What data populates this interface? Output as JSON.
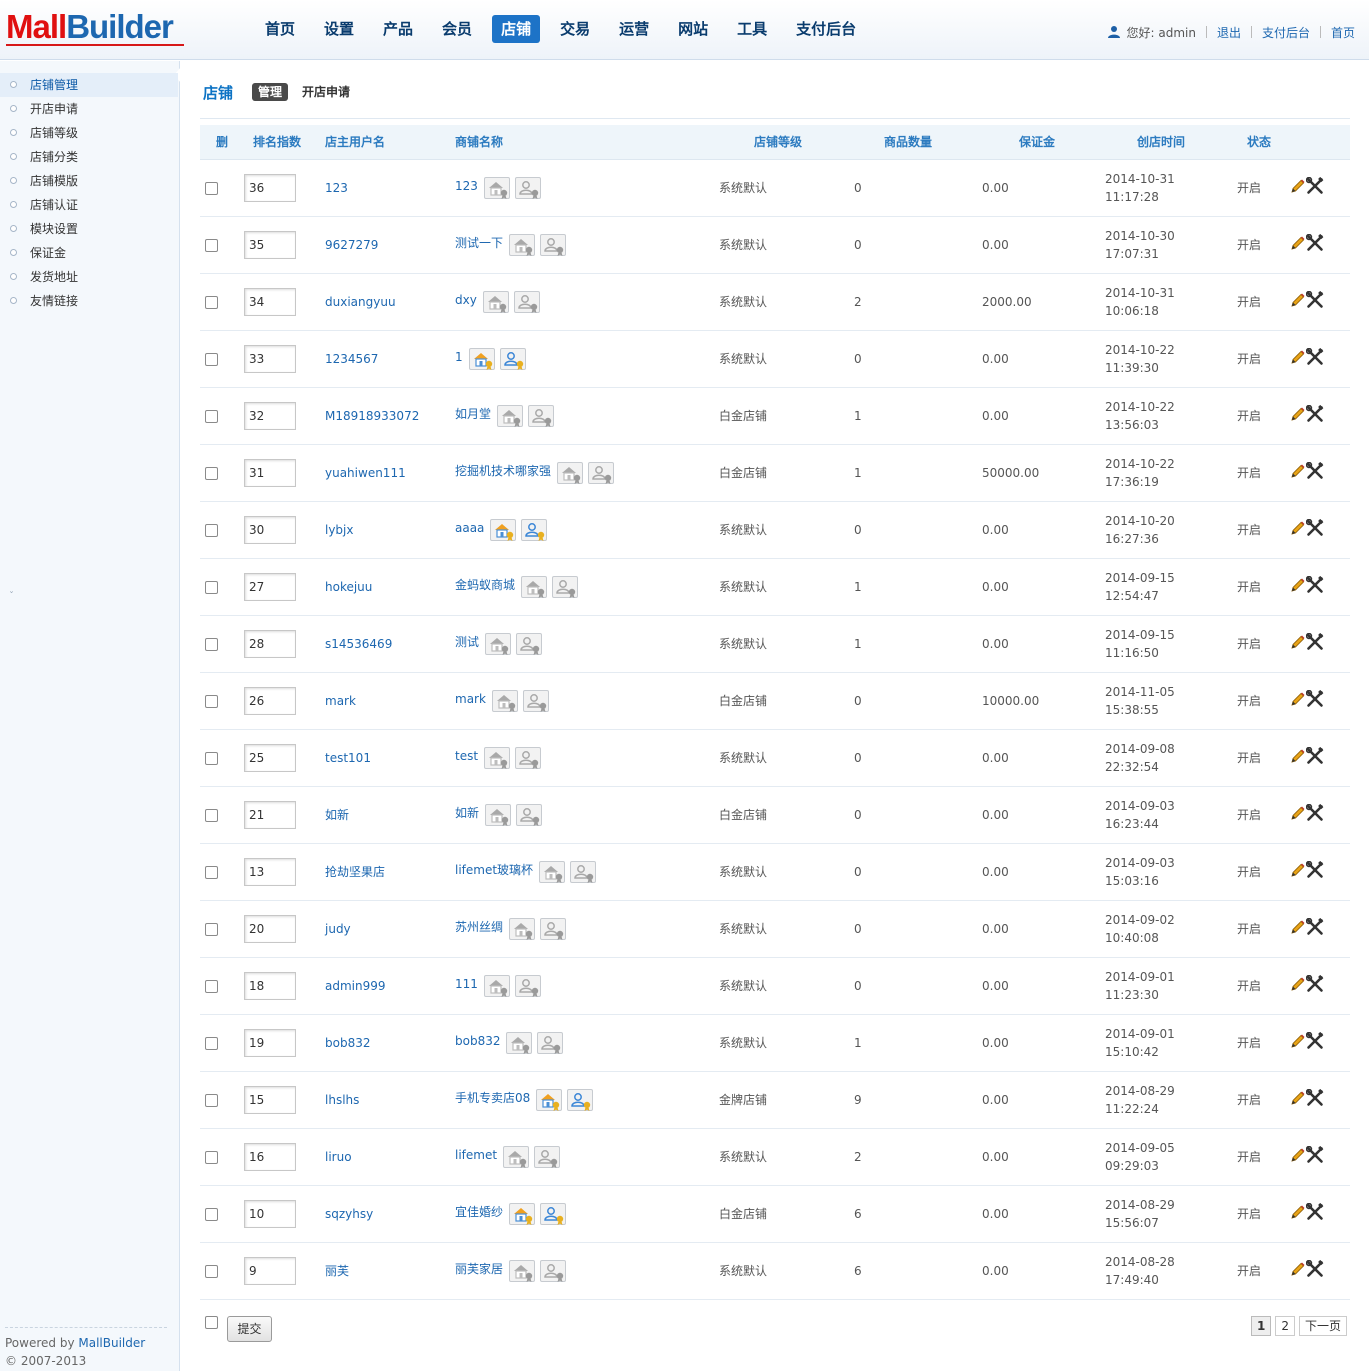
{
  "header": {
    "logo_left": "Mall",
    "logo_right": "Builder",
    "nav": [
      "首页",
      "设置",
      "产品",
      "会员",
      "店铺",
      "交易",
      "运营",
      "网站",
      "工具",
      "支付后台"
    ],
    "active_nav": "店铺",
    "greeting": "您好: admin",
    "links": [
      "退出",
      "支付后台",
      "首页"
    ]
  },
  "sidebar": {
    "items": [
      "店铺管理",
      "开店申请",
      "店铺等级",
      "店铺分类",
      "店铺模版",
      "店铺认证",
      "模块设置",
      "保证金",
      "发货地址",
      "友情链接"
    ],
    "active": "店铺管理",
    "toggle": "ˇ",
    "powered_prefix": "Powered by ",
    "powered_brand": "MallBuilder",
    "copyright": "© 2007-2013"
  },
  "breadcrumb": {
    "title": "店铺",
    "tab_active": "管理",
    "tab_other": "开店申请"
  },
  "table": {
    "headers": [
      "删",
      "排名指数",
      "店主用户名",
      "商铺名称",
      "店铺等级",
      "商品数量",
      "保证金",
      "创店时间",
      "状态"
    ],
    "rows": [
      {
        "rank": "36",
        "user": "123",
        "shop": "123",
        "badges": [
          "gray",
          "gray"
        ],
        "level": "系统默认",
        "count": "0",
        "deposit": "0.00",
        "date": "2014-10-31",
        "time": "11:17:28",
        "status": "开启"
      },
      {
        "rank": "35",
        "user": "9627279",
        "shop": "测试一下",
        "badges": [
          "gray",
          "gray"
        ],
        "level": "系统默认",
        "count": "0",
        "deposit": "0.00",
        "date": "2014-10-30",
        "time": "17:07:31",
        "status": "开启"
      },
      {
        "rank": "34",
        "user": "duxiangyuu",
        "shop": "dxy",
        "badges": [
          "gray",
          "gray"
        ],
        "level": "系统默认",
        "count": "2",
        "deposit": "2000.00",
        "date": "2014-10-31",
        "time": "10:06:18",
        "status": "开启"
      },
      {
        "rank": "33",
        "user": "1234567",
        "shop": "1",
        "badges": [
          "color",
          "color"
        ],
        "level": "系统默认",
        "count": "0",
        "deposit": "0.00",
        "date": "2014-10-22",
        "time": "11:39:30",
        "status": "开启"
      },
      {
        "rank": "32",
        "user": "M18918933072",
        "shop": "如月堂",
        "badges": [
          "gray",
          "gray"
        ],
        "level": "白金店铺",
        "count": "1",
        "deposit": "0.00",
        "date": "2014-10-22",
        "time": "13:56:03",
        "status": "开启"
      },
      {
        "rank": "31",
        "user": "yuahiwen111",
        "shop": "挖掘机技术哪家强",
        "badges": [
          "gray",
          "gray"
        ],
        "level": "白金店铺",
        "count": "1",
        "deposit": "50000.00",
        "date": "2014-10-22",
        "time": "17:36:19",
        "status": "开启"
      },
      {
        "rank": "30",
        "user": "lybjx",
        "shop": "aaaa",
        "badges": [
          "color",
          "color"
        ],
        "level": "系统默认",
        "count": "0",
        "deposit": "0.00",
        "date": "2014-10-20",
        "time": "16:27:36",
        "status": "开启"
      },
      {
        "rank": "27",
        "user": "hokejuu",
        "shop": "金蚂蚁商城",
        "badges": [
          "gray",
          "gray"
        ],
        "level": "系统默认",
        "count": "1",
        "deposit": "0.00",
        "date": "2014-09-15",
        "time": "12:54:47",
        "status": "开启"
      },
      {
        "rank": "28",
        "user": "s14536469",
        "shop": "测试",
        "badges": [
          "gray",
          "gray"
        ],
        "level": "系统默认",
        "count": "1",
        "deposit": "0.00",
        "date": "2014-09-15",
        "time": "11:16:50",
        "status": "开启"
      },
      {
        "rank": "26",
        "user": "mark",
        "shop": "mark",
        "badges": [
          "gray",
          "gray"
        ],
        "level": "白金店铺",
        "count": "0",
        "deposit": "10000.00",
        "date": "2014-11-05",
        "time": "15:38:55",
        "status": "开启"
      },
      {
        "rank": "25",
        "user": "test101",
        "shop": "test",
        "badges": [
          "gray",
          "gray"
        ],
        "level": "系统默认",
        "count": "0",
        "deposit": "0.00",
        "date": "2014-09-08",
        "time": "22:32:54",
        "status": "开启"
      },
      {
        "rank": "21",
        "user": "如新",
        "shop": "如新",
        "badges": [
          "gray",
          "gray"
        ],
        "level": "白金店铺",
        "count": "0",
        "deposit": "0.00",
        "date": "2014-09-03",
        "time": "16:23:44",
        "status": "开启"
      },
      {
        "rank": "13",
        "user": "抢劫坚果店",
        "shop": "lifemet玻璃杯",
        "badges": [
          "gray",
          "gray"
        ],
        "level": "系统默认",
        "count": "0",
        "deposit": "0.00",
        "date": "2014-09-03",
        "time": "15:03:16",
        "status": "开启"
      },
      {
        "rank": "20",
        "user": "judy",
        "shop": "苏州丝绸",
        "badges": [
          "gray",
          "gray"
        ],
        "level": "系统默认",
        "count": "0",
        "deposit": "0.00",
        "date": "2014-09-02",
        "time": "10:40:08",
        "status": "开启"
      },
      {
        "rank": "18",
        "user": "admin999",
        "shop": "111",
        "badges": [
          "gray",
          "gray"
        ],
        "level": "系统默认",
        "count": "0",
        "deposit": "0.00",
        "date": "2014-09-01",
        "time": "11:23:30",
        "status": "开启"
      },
      {
        "rank": "19",
        "user": "bob832",
        "shop": "bob832",
        "badges": [
          "gray",
          "gray"
        ],
        "level": "系统默认",
        "count": "1",
        "deposit": "0.00",
        "date": "2014-09-01",
        "time": "15:10:42",
        "status": "开启"
      },
      {
        "rank": "15",
        "user": "lhslhs",
        "shop": "手机专卖店08",
        "badges": [
          "color",
          "color"
        ],
        "level": "金牌店铺",
        "count": "9",
        "deposit": "0.00",
        "date": "2014-08-29",
        "time": "11:22:24",
        "status": "开启"
      },
      {
        "rank": "16",
        "user": "liruo",
        "shop": "lifemet",
        "badges": [
          "gray",
          "gray"
        ],
        "level": "系统默认",
        "count": "2",
        "deposit": "0.00",
        "date": "2014-09-05",
        "time": "09:29:03",
        "status": "开启"
      },
      {
        "rank": "10",
        "user": "sqzyhsy",
        "shop": "宜佳婚纱",
        "badges": [
          "color",
          "color"
        ],
        "level": "白金店铺",
        "count": "6",
        "deposit": "0.00",
        "date": "2014-08-29",
        "time": "15:56:07",
        "status": "开启"
      },
      {
        "rank": "9",
        "user": "丽芙",
        "shop": "丽芙家居",
        "badges": [
          "gray",
          "gray"
        ],
        "level": "系统默认",
        "count": "6",
        "deposit": "0.00",
        "date": "2014-08-28",
        "time": "17:49:40",
        "status": "开启"
      }
    ]
  },
  "footer": {
    "submit_label": "提交",
    "pages": [
      "1",
      "2"
    ],
    "current_page": "1",
    "next_label": "下一页"
  },
  "colors": {
    "accent": "#1d73c7",
    "link": "#1d67b0",
    "header_text": "#2c7bc0",
    "logo_red": "#e01010"
  },
  "icons": {
    "user": "user-icon",
    "store_badge": "store-cert-icon",
    "person_badge": "owner-cert-icon",
    "edit": "pencil-icon",
    "tools": "wrench-icon"
  }
}
